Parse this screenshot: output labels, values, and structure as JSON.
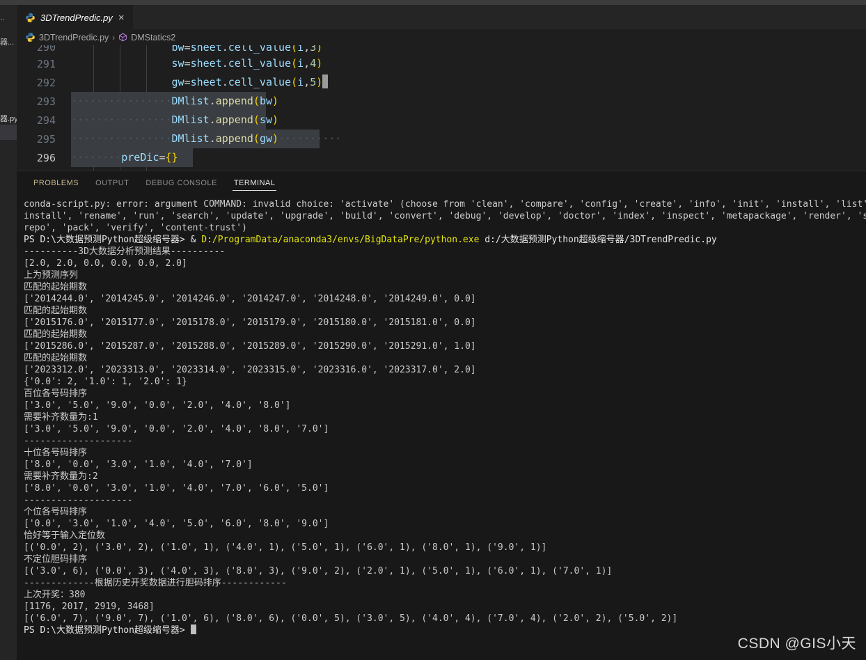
{
  "window": {
    "background_color": "#1e1e1e",
    "accent_color": "#e5e510"
  },
  "activity_sliver": {
    "fragment_top": "··",
    "fragment_folder": "器...",
    "fragment_file": "器.py"
  },
  "editor_tabs": [
    {
      "label": "3DTrendPredic.py",
      "icon": "python-icon",
      "close": "×",
      "active": true
    }
  ],
  "breadcrumb": {
    "file": "3DTrendPredic.py",
    "separator": "›",
    "symbol": "DMStatics2"
  },
  "editor": {
    "lines": [
      {
        "number": "290",
        "clipped": true,
        "selected": false,
        "tokens": [
          {
            "t": "                ",
            "c": "tok-plain"
          },
          {
            "t": "bw",
            "c": "tok-var"
          },
          {
            "t": "=",
            "c": "tok-op"
          },
          {
            "t": "sheet",
            "c": "tok-var"
          },
          {
            "t": ".",
            "c": "tok-op"
          },
          {
            "t": "cell_value",
            "c": "tok-var"
          },
          {
            "t": "(",
            "c": "tok-paren"
          },
          {
            "t": "i",
            "c": "tok-var"
          },
          {
            "t": ",",
            "c": "tok-op"
          },
          {
            "t": "3",
            "c": "tok-num"
          },
          {
            "t": ")",
            "c": "tok-paren"
          }
        ]
      },
      {
        "number": "291",
        "clipped": false,
        "selected": false,
        "tokens": [
          {
            "t": "                ",
            "c": "tok-plain"
          },
          {
            "t": "sw",
            "c": "tok-var"
          },
          {
            "t": "=",
            "c": "tok-op"
          },
          {
            "t": "sheet",
            "c": "tok-var"
          },
          {
            "t": ".",
            "c": "tok-op"
          },
          {
            "t": "cell_value",
            "c": "tok-var"
          },
          {
            "t": "(",
            "c": "tok-paren"
          },
          {
            "t": "i",
            "c": "tok-var"
          },
          {
            "t": ",",
            "c": "tok-op"
          },
          {
            "t": "4",
            "c": "tok-num"
          },
          {
            "t": ")",
            "c": "tok-paren"
          }
        ]
      },
      {
        "number": "292",
        "clipped": false,
        "selected": false,
        "tokens": [
          {
            "t": "                ",
            "c": "tok-plain"
          },
          {
            "t": "gw",
            "c": "tok-var"
          },
          {
            "t": "=",
            "c": "tok-op"
          },
          {
            "t": "sheet",
            "c": "tok-var"
          },
          {
            "t": ".",
            "c": "tok-op"
          },
          {
            "t": "cell_value",
            "c": "tok-var"
          },
          {
            "t": "(",
            "c": "tok-paren"
          },
          {
            "t": "i",
            "c": "tok-var"
          },
          {
            "t": ",",
            "c": "tok-op"
          },
          {
            "t": "5",
            "c": "tok-num"
          },
          {
            "t": ")",
            "c": "tok-paren"
          }
        ]
      },
      {
        "number": "293",
        "clipped": false,
        "selected": true,
        "sel_width": 280,
        "tokens": [
          {
            "t": "················",
            "c": "wsdot"
          },
          {
            "t": "DMlist",
            "c": "tok-var"
          },
          {
            "t": ".",
            "c": "tok-op"
          },
          {
            "t": "append",
            "c": "tok-fn"
          },
          {
            "t": "(",
            "c": "tok-paren"
          },
          {
            "t": "bw",
            "c": "tok-var"
          },
          {
            "t": ")",
            "c": "tok-paren"
          }
        ]
      },
      {
        "number": "294",
        "clipped": false,
        "selected": true,
        "sel_width": 280,
        "tokens": [
          {
            "t": "················",
            "c": "wsdot"
          },
          {
            "t": "DMlist",
            "c": "tok-var"
          },
          {
            "t": ".",
            "c": "tok-op"
          },
          {
            "t": "append",
            "c": "tok-fn"
          },
          {
            "t": "(",
            "c": "tok-paren"
          },
          {
            "t": "sw",
            "c": "tok-var"
          },
          {
            "t": ")",
            "c": "tok-paren"
          }
        ]
      },
      {
        "number": "295",
        "clipped": false,
        "selected": true,
        "sel_width": 357,
        "tokens": [
          {
            "t": "················",
            "c": "wsdot"
          },
          {
            "t": "DMlist",
            "c": "tok-var"
          },
          {
            "t": ".",
            "c": "tok-op"
          },
          {
            "t": "append",
            "c": "tok-fn"
          },
          {
            "t": "(",
            "c": "tok-paren"
          },
          {
            "t": "gw",
            "c": "tok-var"
          },
          {
            "t": ")",
            "c": "tok-paren"
          },
          {
            "t": "··········",
            "c": "wsdot"
          }
        ]
      },
      {
        "number": "296",
        "clipped": false,
        "selected": true,
        "sel_width": 175,
        "current": true,
        "tokens": [
          {
            "t": "········",
            "c": "wsdot"
          },
          {
            "t": "preDic",
            "c": "tok-var"
          },
          {
            "t": "=",
            "c": "tok-op"
          },
          {
            "t": "{}",
            "c": "tok-paren"
          }
        ]
      }
    ]
  },
  "panel": {
    "tabs": [
      {
        "label": "PROBLEMS",
        "active": false,
        "style": "problems"
      },
      {
        "label": "OUTPUT",
        "active": false,
        "style": ""
      },
      {
        "label": "DEBUG CONSOLE",
        "active": false,
        "style": ""
      },
      {
        "label": "TERMINAL",
        "active": true,
        "style": ""
      }
    ]
  },
  "terminal": {
    "lines": [
      {
        "text": "conda-script.py: error: argument COMMAND: invalid choice: 'activate' (choose from 'clean', 'compare', 'config', 'create', 'info', 'init', 'install', 'list', 'notices', 'pac",
        "color": "c-dim"
      },
      {
        "text": "install', 'rename', 'run', 'search', 'update', 'upgrade', 'build', 'convert', 'debug', 'develop', 'doctor', 'index', 'inspect', 'metapackage', 'render', 'skeleton', 'server",
        "color": "c-dim"
      },
      {
        "text": "repo', 'pack', 'verify', 'content-trust')",
        "color": "c-dim"
      },
      {
        "segments": [
          {
            "t": "PS D:\\大数据预测Python超级缩号器> ",
            "c": "c-white"
          },
          {
            "t": "& ",
            "c": "c-white"
          },
          {
            "t": "D:/ProgramData/anaconda3/envs/BigDataPre/python.exe",
            "c": "c-yellow"
          },
          {
            "t": " d:/大数据预测Python超级缩号器/3DTrendPredic.py",
            "c": "c-white"
          }
        ]
      },
      {
        "text": "----------3D大数据分析预测结果----------",
        "color": "c-dim"
      },
      {
        "text": "[2.0, 2.0, 0.0, 0.0, 0.0, 2.0]",
        "color": "c-dim"
      },
      {
        "text": "上为预测序列",
        "color": "c-dim"
      },
      {
        "text": "匹配的起始期数",
        "color": "c-dim"
      },
      {
        "text": "['2014244.0', '2014245.0', '2014246.0', '2014247.0', '2014248.0', '2014249.0', 0.0]",
        "color": "c-dim"
      },
      {
        "text": "匹配的起始期数",
        "color": "c-dim"
      },
      {
        "text": "['2015176.0', '2015177.0', '2015178.0', '2015179.0', '2015180.0', '2015181.0', 0.0]",
        "color": "c-dim"
      },
      {
        "text": "匹配的起始期数",
        "color": "c-dim"
      },
      {
        "text": "['2015286.0', '2015287.0', '2015288.0', '2015289.0', '2015290.0', '2015291.0', 1.0]",
        "color": "c-dim"
      },
      {
        "text": "匹配的起始期数",
        "color": "c-dim"
      },
      {
        "text": "['2023312.0', '2023313.0', '2023314.0', '2023315.0', '2023316.0', '2023317.0', 2.0]",
        "color": "c-dim"
      },
      {
        "text": "{'0.0': 2, '1.0': 1, '2.0': 1}",
        "color": "c-dim"
      },
      {
        "text": "百位各号码排序",
        "color": "c-dim"
      },
      {
        "text": "['3.0', '5.0', '9.0', '0.0', '2.0', '4.0', '8.0']",
        "color": "c-dim"
      },
      {
        "text": "需要补齐数量为:1",
        "color": "c-dim"
      },
      {
        "text": "['3.0', '5.0', '9.0', '0.0', '2.0', '4.0', '8.0', '7.0']",
        "color": "c-dim"
      },
      {
        "text": "--------------------",
        "color": "c-dim"
      },
      {
        "text": "十位各号码排序",
        "color": "c-dim"
      },
      {
        "text": "['8.0', '0.0', '3.0', '1.0', '4.0', '7.0']",
        "color": "c-dim"
      },
      {
        "text": "需要补齐数量为:2",
        "color": "c-dim"
      },
      {
        "text": "['8.0', '0.0', '3.0', '1.0', '4.0', '7.0', '6.0', '5.0']",
        "color": "c-dim"
      },
      {
        "text": "--------------------",
        "color": "c-dim"
      },
      {
        "text": "个位各号码排序",
        "color": "c-dim"
      },
      {
        "text": "['0.0', '3.0', '1.0', '4.0', '5.0', '6.0', '8.0', '9.0']",
        "color": "c-dim"
      },
      {
        "text": "恰好等于输入定位数",
        "color": "c-dim"
      },
      {
        "text": "[('0.0', 2), ('3.0', 2), ('1.0', 1), ('4.0', 1), ('5.0', 1), ('6.0', 1), ('8.0', 1), ('9.0', 1)]",
        "color": "c-dim"
      },
      {
        "text": "不定位胆码排序",
        "color": "c-dim"
      },
      {
        "text": "[('3.0', 6), ('0.0', 3), ('4.0', 3), ('8.0', 3), ('9.0', 2), ('2.0', 1), ('5.0', 1), ('6.0', 1), ('7.0', 1)]",
        "color": "c-dim"
      },
      {
        "text": "-------------根据历史开奖数据进行胆码排序------------",
        "color": "c-dim"
      },
      {
        "text": "上次开奖：380",
        "color": "c-dim"
      },
      {
        "text": "[1176, 2017, 2919, 3468]",
        "color": "c-dim"
      },
      {
        "text": "[('6.0', 7), ('9.0', 7), ('1.0', 6), ('8.0', 6), ('0.0', 5), ('3.0', 5), ('4.0', 4), ('7.0', 4), ('2.0', 2), ('5.0', 2)]",
        "color": "c-dim"
      }
    ],
    "prompt": "PS D:\\大数据预测Python超级缩号器> "
  },
  "watermark": {
    "text": "CSDN @GIS小天"
  }
}
